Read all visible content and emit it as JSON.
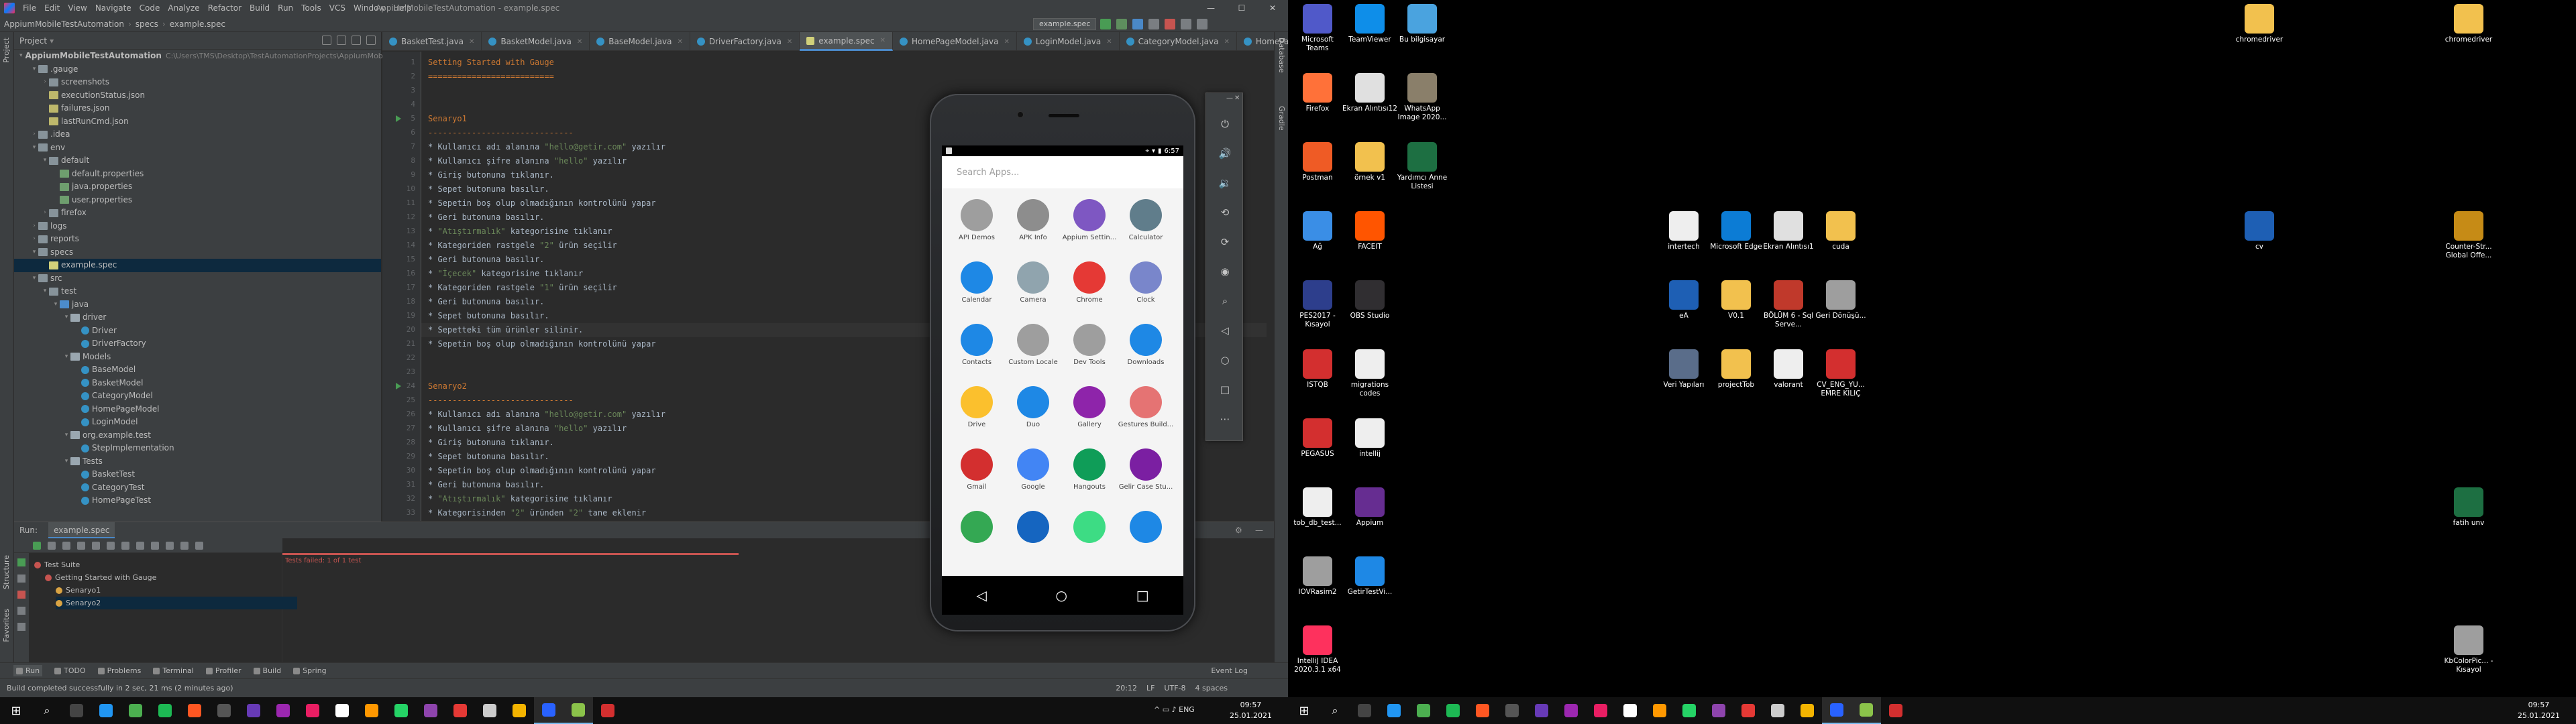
{
  "ide": {
    "window_title": "AppiumMobileTestAutomation - example.spec",
    "menu": [
      "File",
      "Edit",
      "View",
      "Navigate",
      "Code",
      "Analyze",
      "Refactor",
      "Build",
      "Run",
      "Tools",
      "VCS",
      "Window",
      "Help"
    ],
    "breadcrumbs": [
      "AppiumMobileTestAutomation",
      "specs",
      "example.spec"
    ],
    "run_config": "example.spec",
    "project_panel": {
      "title": "Project",
      "rows": [
        {
          "depth": 0,
          "arrow": "▾",
          "icon": "folder",
          "label": "AppiumMobileTestAutomation",
          "path": "C:\\Users\\TMS\\Desktop\\TestAutomationProjects\\AppiumMobileTestAutomation",
          "bold": true
        },
        {
          "depth": 1,
          "arrow": "▾",
          "icon": "folder",
          "label": ".gauge"
        },
        {
          "depth": 2,
          "arrow": "›",
          "icon": "folder",
          "label": "screenshots"
        },
        {
          "depth": 2,
          "arrow": "",
          "icon": "json",
          "label": "executionStatus.json"
        },
        {
          "depth": 2,
          "arrow": "",
          "icon": "json",
          "label": "failures.json"
        },
        {
          "depth": 2,
          "arrow": "",
          "icon": "json",
          "label": "lastRunCmd.json"
        },
        {
          "depth": 1,
          "arrow": "›",
          "icon": "folder",
          "label": ".idea"
        },
        {
          "depth": 1,
          "arrow": "▾",
          "icon": "folder",
          "label": "env"
        },
        {
          "depth": 2,
          "arrow": "▾",
          "icon": "folder",
          "label": "default"
        },
        {
          "depth": 3,
          "arrow": "",
          "icon": "prop",
          "label": "default.properties"
        },
        {
          "depth": 3,
          "arrow": "",
          "icon": "prop",
          "label": "java.properties"
        },
        {
          "depth": 3,
          "arrow": "",
          "icon": "prop",
          "label": "user.properties"
        },
        {
          "depth": 2,
          "arrow": "›",
          "icon": "folder",
          "label": "firefox"
        },
        {
          "depth": 1,
          "arrow": "›",
          "icon": "folder",
          "label": "logs"
        },
        {
          "depth": 1,
          "arrow": "›",
          "icon": "folder",
          "label": "reports"
        },
        {
          "depth": 1,
          "arrow": "▾",
          "icon": "folder",
          "label": "specs"
        },
        {
          "depth": 2,
          "arrow": "",
          "icon": "spec",
          "label": "example.spec",
          "selected": true
        },
        {
          "depth": 1,
          "arrow": "▾",
          "icon": "folder",
          "label": "src"
        },
        {
          "depth": 2,
          "arrow": "▾",
          "icon": "folder",
          "label": "test"
        },
        {
          "depth": 3,
          "arrow": "▾",
          "icon": "src",
          "label": "java"
        },
        {
          "depth": 4,
          "arrow": "▾",
          "icon": "pkg",
          "label": "driver"
        },
        {
          "depth": 5,
          "arrow": "",
          "icon": "class",
          "label": "Driver"
        },
        {
          "depth": 5,
          "arrow": "",
          "icon": "class",
          "label": "DriverFactory"
        },
        {
          "depth": 4,
          "arrow": "▾",
          "icon": "pkg",
          "label": "Models"
        },
        {
          "depth": 5,
          "arrow": "",
          "icon": "class",
          "label": "BaseModel"
        },
        {
          "depth": 5,
          "arrow": "",
          "icon": "class",
          "label": "BasketModel"
        },
        {
          "depth": 5,
          "arrow": "",
          "icon": "class",
          "label": "CategoryModel"
        },
        {
          "depth": 5,
          "arrow": "",
          "icon": "class",
          "label": "HomePageModel"
        },
        {
          "depth": 5,
          "arrow": "",
          "icon": "class",
          "label": "LoginModel"
        },
        {
          "depth": 4,
          "arrow": "▾",
          "icon": "pkg",
          "label": "org.example.test"
        },
        {
          "depth": 5,
          "arrow": "",
          "icon": "class",
          "label": "StepImplementation"
        },
        {
          "depth": 4,
          "arrow": "▾",
          "icon": "pkg",
          "label": "Tests"
        },
        {
          "depth": 5,
          "arrow": "",
          "icon": "class",
          "label": "BasketTest"
        },
        {
          "depth": 5,
          "arrow": "",
          "icon": "class",
          "label": "CategoryTest"
        },
        {
          "depth": 5,
          "arrow": "",
          "icon": "class",
          "label": "HomePageTest"
        }
      ]
    },
    "tabs": [
      "BasketTest.java",
      "BasketModel.java",
      "BaseModel.java",
      "DriverFactory.java",
      "example.spec",
      "HomePageModel.java",
      "LoginModel.java",
      "CategoryModel.java",
      "HomePageTest.java"
    ],
    "active_tab": "example.spec",
    "editor_lines": [
      {
        "n": 1,
        "kind": "h",
        "text": "Setting Started with Gauge"
      },
      {
        "n": 2,
        "kind": "u",
        "text": "=========================="
      },
      {
        "n": 3,
        "kind": "s",
        "text": ""
      },
      {
        "n": 4,
        "kind": "s",
        "text": ""
      },
      {
        "n": 5,
        "kind": "h",
        "text": "Senaryo1",
        "run": true
      },
      {
        "n": 6,
        "kind": "u",
        "text": "------------------------------"
      },
      {
        "n": 7,
        "kind": "s",
        "text": "* Kullanıcı adı alanına \"hello@getir.com\" yazılır"
      },
      {
        "n": 8,
        "kind": "s",
        "text": "* Kullanıcı şifre alanına \"hello\" yazılır"
      },
      {
        "n": 9,
        "kind": "s",
        "text": "* Giriş butonuna tıklanır."
      },
      {
        "n": 10,
        "kind": "s",
        "text": "* Sepet butonuna basılır."
      },
      {
        "n": 11,
        "kind": "s",
        "text": "* Sepetin boş olup olmadığının kontrolünü yapar"
      },
      {
        "n": 12,
        "kind": "s",
        "text": "* Geri butonuna basılır."
      },
      {
        "n": 13,
        "kind": "s",
        "text": "* \"Atıştırmalık\" kategorisine tıklanır"
      },
      {
        "n": 14,
        "kind": "s",
        "text": "* Kategoriden rastgele \"2\" ürün seçilir"
      },
      {
        "n": 15,
        "kind": "s",
        "text": "* Geri butonuna basılır."
      },
      {
        "n": 16,
        "kind": "s",
        "text": "* \"İçecek\" kategorisine tıklanır"
      },
      {
        "n": 17,
        "kind": "s",
        "text": "* Kategoriden rastgele \"1\" ürün seçilir"
      },
      {
        "n": 18,
        "kind": "s",
        "text": "* Geri butonuna basılır."
      },
      {
        "n": 19,
        "kind": "s",
        "text": "* Sepet butonuna basılır."
      },
      {
        "n": 20,
        "kind": "s",
        "text": "* Sepetteki tüm ürünler silinir.",
        "current": true
      },
      {
        "n": 21,
        "kind": "s",
        "text": "* Sepetin boş olup olmadığının kontrolünü yapar"
      },
      {
        "n": 22,
        "kind": "s",
        "text": ""
      },
      {
        "n": 23,
        "kind": "s",
        "text": ""
      },
      {
        "n": 24,
        "kind": "h",
        "text": "Senaryo2",
        "run": true
      },
      {
        "n": 25,
        "kind": "u",
        "text": "------------------------------"
      },
      {
        "n": 26,
        "kind": "s",
        "text": "* Kullanıcı adı alanına \"hello@getir.com\" yazılır"
      },
      {
        "n": 27,
        "kind": "s",
        "text": "* Kullanıcı şifre alanına \"hello\" yazılır"
      },
      {
        "n": 28,
        "kind": "s",
        "text": "* Giriş butonuna tıklanır."
      },
      {
        "n": 29,
        "kind": "s",
        "text": "* Sepet butonuna basılır."
      },
      {
        "n": 30,
        "kind": "s",
        "text": "* Sepetin boş olup olmadığının kontrolünü yapar"
      },
      {
        "n": 31,
        "kind": "s",
        "text": "* Geri butonuna basılır."
      },
      {
        "n": 32,
        "kind": "s",
        "text": "* \"Atıştırmalık\" kategorisine tıklanır"
      },
      {
        "n": 33,
        "kind": "s",
        "text": "* Kategorisinden \"2\" üründen \"2\" tane eklenir"
      }
    ],
    "run_panel": {
      "label": "Run:",
      "tab": "example.spec",
      "tree": [
        {
          "depth": 0,
          "label": "Test Suite",
          "status": "fail"
        },
        {
          "depth": 1,
          "label": "Getting Started with Gauge",
          "status": "fail"
        },
        {
          "depth": 2,
          "label": "Senaryo1",
          "status": "warn"
        },
        {
          "depth": 2,
          "label": "Senaryo2",
          "status": "warn",
          "selected": true
        }
      ],
      "progress_text": "Tests failed: 1 of 1 test"
    },
    "bottom_tools": [
      "Run",
      "TODO",
      "Problems",
      "Terminal",
      "Profiler",
      "Build",
      "Spring"
    ],
    "event_log": "Event Log",
    "status_message": "Build completed successfully in 2 sec, 21 ms (2 minutes ago)",
    "status_right": [
      "20:12",
      "LF",
      "UTF-8",
      "4 spaces"
    ],
    "side_labels_left": [
      "Project",
      "Structure",
      "Favorites"
    ],
    "side_labels_right": [
      "Database",
      "Gradle"
    ]
  },
  "emulator": {
    "status_time": "6:57",
    "search_placeholder": "Search Apps...",
    "apps": [
      {
        "label": "API Demos",
        "color": "#9e9e9e"
      },
      {
        "label": "APK Info",
        "color": "#8d8d8d"
      },
      {
        "label": "Appium Settin...",
        "color": "#7e57c2"
      },
      {
        "label": "Calculator",
        "color": "#607d8b"
      },
      {
        "label": "Calendar",
        "color": "#1e88e5"
      },
      {
        "label": "Camera",
        "color": "#90a4ae"
      },
      {
        "label": "Chrome",
        "color": "#e53935"
      },
      {
        "label": "Clock",
        "color": "#7986cb"
      },
      {
        "label": "Contacts",
        "color": "#1e88e5"
      },
      {
        "label": "Custom Locale",
        "color": "#9e9e9e"
      },
      {
        "label": "Dev Tools",
        "color": "#9e9e9e"
      },
      {
        "label": "Downloads",
        "color": "#1e88e5"
      },
      {
        "label": "Drive",
        "color": "#fbc02d"
      },
      {
        "label": "Duo",
        "color": "#1e88e5"
      },
      {
        "label": "Gallery",
        "color": "#8e24aa"
      },
      {
        "label": "Gestures Build...",
        "color": "#e57373"
      },
      {
        "label": "Gmail",
        "color": "#d32f2f"
      },
      {
        "label": "Google",
        "color": "#4285f4"
      },
      {
        "label": "Hangouts",
        "color": "#0f9d58"
      },
      {
        "label": "Gelir Case Stu...",
        "color": "#7b1fa2"
      },
      {
        "label": "",
        "color": "#34a853"
      },
      {
        "label": "",
        "color": "#1565c0"
      },
      {
        "label": "",
        "color": "#3ddc84"
      },
      {
        "label": "",
        "color": "#1e88e5"
      }
    ]
  },
  "desktop": {
    "icons": [
      {
        "label": "Microsoft Teams",
        "color": "#5059c9",
        "col": 0,
        "row": 0
      },
      {
        "label": "TeamViewer",
        "color": "#0e8ee9",
        "col": 1,
        "row": 0
      },
      {
        "label": "Bu bilgisayar",
        "color": "#4aa3df",
        "col": 2,
        "row": 0
      },
      {
        "label": "Firefox",
        "color": "#ff7139",
        "col": 0,
        "row": 1
      },
      {
        "label": "Ekran Alıntısı12",
        "color": "#e0e0e0",
        "col": 1,
        "row": 1
      },
      {
        "label": "WhatsApp Image 2020...",
        "color": "#8a7f6a",
        "col": 2,
        "row": 1
      },
      {
        "label": "Postman",
        "color": "#ef5b25",
        "col": 0,
        "row": 2
      },
      {
        "label": "örnek v1",
        "color": "#f2c14e",
        "col": 1,
        "row": 2
      },
      {
        "label": "Yardımcı Anne Listesi",
        "color": "#1d6f42",
        "col": 2,
        "row": 2
      },
      {
        "label": "Ağ",
        "color": "#3a8ee6",
        "col": 0,
        "row": 3
      },
      {
        "label": "FACEIT",
        "color": "#ff5500",
        "col": 1,
        "row": 3
      },
      {
        "label": "PES2017 - Kısayol",
        "color": "#2d3e8c",
        "col": 0,
        "row": 4
      },
      {
        "label": "OBS Studio",
        "color": "#302e31",
        "col": 1,
        "row": 4
      },
      {
        "label": "ISTQB",
        "color": "#d32f2f",
        "col": 0,
        "row": 5
      },
      {
        "label": "migrations codes",
        "color": "#eeeeee",
        "col": 1,
        "row": 5
      },
      {
        "label": "PEGASUS",
        "color": "#d32f2f",
        "col": 0,
        "row": 6
      },
      {
        "label": "intellij",
        "color": "#eeeeee",
        "col": 1,
        "row": 6
      },
      {
        "label": "tob_db_test...",
        "color": "#eeeeee",
        "col": 0,
        "row": 7
      },
      {
        "label": "Appium",
        "color": "#662d91",
        "col": 1,
        "row": 7
      },
      {
        "label": "IOVRasim2",
        "color": "#9e9e9e",
        "col": 0,
        "row": 8
      },
      {
        "label": "GetirTestVi...",
        "color": "#1e88e5",
        "col": 1,
        "row": 8
      },
      {
        "label": "IntelliJ IDEA 2020.3.1 x64",
        "color": "#fe315d",
        "col": 0,
        "row": 9
      },
      {
        "label": "intertech",
        "color": "#eeeeee",
        "col": 7,
        "row": 3
      },
      {
        "label": "Microsoft Edge",
        "color": "#0c7cd5",
        "col": 8,
        "row": 3
      },
      {
        "label": "Ekran Alıntısı1",
        "color": "#e0e0e0",
        "col": 9,
        "row": 3
      },
      {
        "label": "cuda",
        "color": "#f2c14e",
        "col": 10,
        "row": 3
      },
      {
        "label": "eA",
        "color": "#1e5fb4",
        "col": 7,
        "row": 4
      },
      {
        "label": "V0.1",
        "color": "#f2c14e",
        "col": 8,
        "row": 4
      },
      {
        "label": "BÖLÜM 6 - Sql Serve...",
        "color": "#c0392b",
        "col": 9,
        "row": 4
      },
      {
        "label": "Geri Dönüşü...",
        "color": "#9e9e9e",
        "col": 10,
        "row": 4
      },
      {
        "label": "Veri Yapıları",
        "color": "#5a6d8a",
        "col": 7,
        "row": 5
      },
      {
        "label": "projectTob",
        "color": "#f2c14e",
        "col": 8,
        "row": 5
      },
      {
        "label": "valorant",
        "color": "#eeeeee",
        "col": 9,
        "row": 5
      },
      {
        "label": "CV_ENG_YU... EMRE KILIÇ",
        "color": "#d32f2f",
        "col": 10,
        "row": 5
      },
      {
        "label": "chromedriver",
        "color": "#f2c14e",
        "col": 18,
        "row": 0
      },
      {
        "label": "chromedriver",
        "color": "#f2c14e",
        "col": 22,
        "row": 0
      },
      {
        "label": "cv",
        "color": "#1e5fb4",
        "col": 18,
        "row": 3
      },
      {
        "label": "Counter-Str... Global Offe...",
        "color": "#c68b16",
        "col": 22,
        "row": 3
      },
      {
        "label": "fatih unv",
        "color": "#1d6f42",
        "col": 22,
        "row": 7
      },
      {
        "label": "KbColorPic... - Kısayol",
        "color": "#9e9e9e",
        "col": 22,
        "row": 9
      }
    ]
  },
  "taskbar": {
    "time": "09:57",
    "date": "25.01.2021"
  },
  "colors": {
    "ide_bg": "#2b2b2b",
    "panel_bg": "#3c3f41",
    "accent": "#4a88c7",
    "fail": "#c75450"
  }
}
